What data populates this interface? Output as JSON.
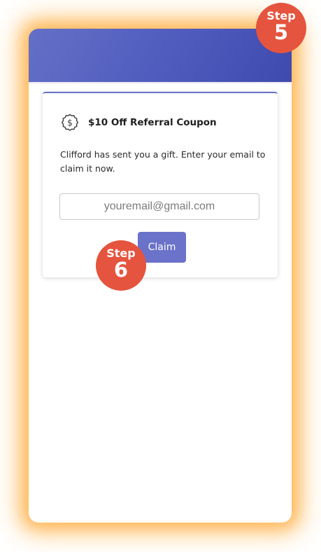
{
  "coupon": {
    "icon": "dollar-badge-icon",
    "title": "$10 Off Referral Coupon",
    "message": "Clifford has sent you a gift. Enter your email to claim it now."
  },
  "form": {
    "email_value": "",
    "email_placeholder": "youremail@gmail.com",
    "claim_label": "Claim"
  },
  "badges": {
    "step5": {
      "word": "Step",
      "number": "5"
    },
    "step6": {
      "word": "Step",
      "number": "6"
    }
  },
  "colors": {
    "header_gradient_start": "#6470c6",
    "header_gradient_end": "#3f4aae",
    "accent": "#6b72c9",
    "badge": "#e5543e",
    "glow": "#ffa530"
  }
}
